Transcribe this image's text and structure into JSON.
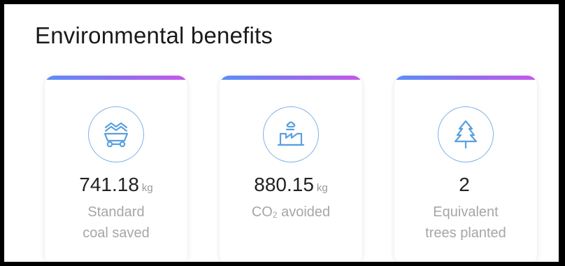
{
  "header": {
    "title": "Environmental benefits"
  },
  "cards": [
    {
      "icon": "coal-cart-icon",
      "value": "741.18",
      "unit": "kg",
      "label_line1": "Standard",
      "label_line2": "coal saved"
    },
    {
      "icon": "factory-icon",
      "value": "880.15",
      "unit": "kg",
      "label_co": "CO",
      "label_sub": "2",
      "label_rest": " avoided"
    },
    {
      "icon": "tree-icon",
      "value": "2",
      "unit": "",
      "label_line1": "Equivalent",
      "label_line2": "trees planted"
    }
  ],
  "colors": {
    "icon_stroke": "#5aa0e0",
    "gradient": [
      "#5b8ff6",
      "#c659e8"
    ]
  }
}
